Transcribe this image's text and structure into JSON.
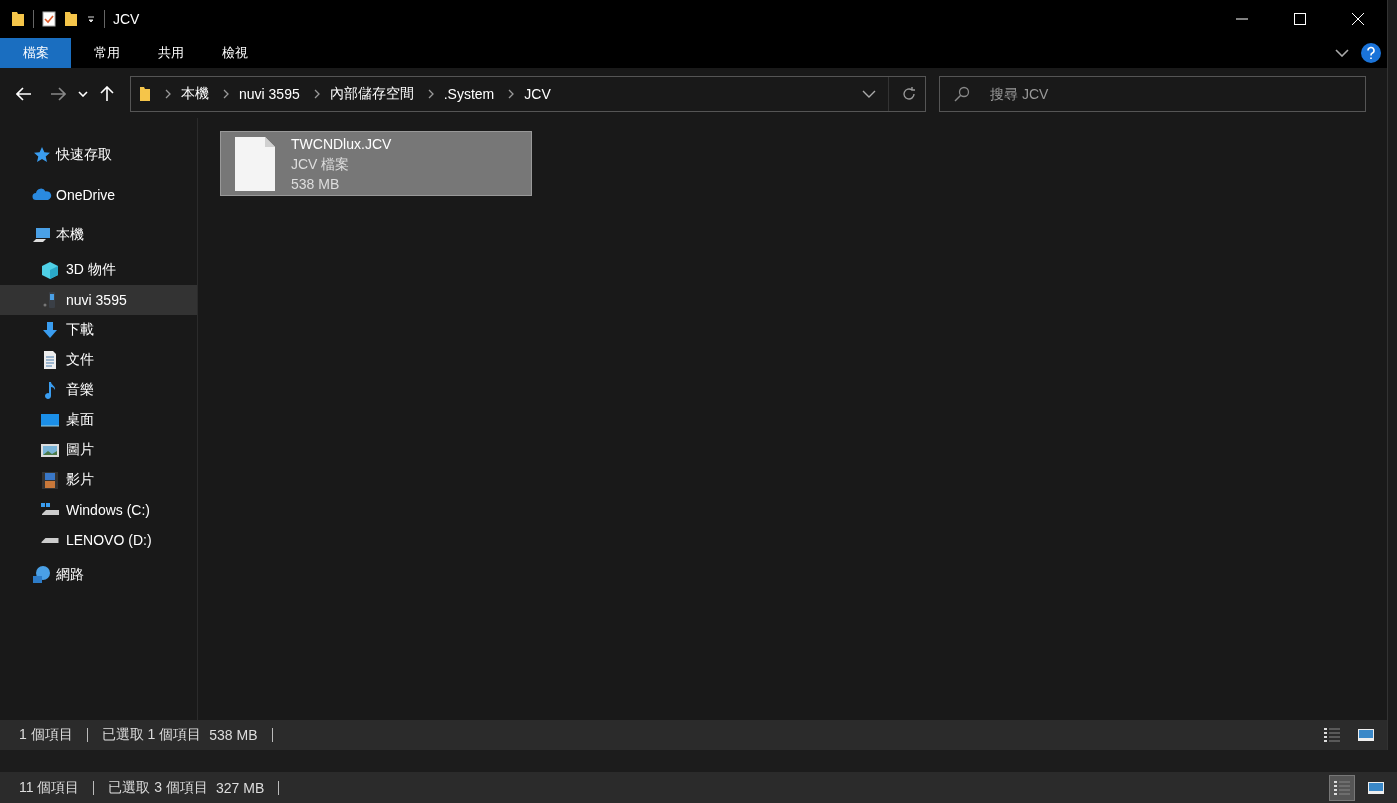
{
  "window": {
    "title": "JCV"
  },
  "ribbon_tabs": [
    {
      "label": "檔案",
      "selected": true
    },
    {
      "label": "常用",
      "selected": false
    },
    {
      "label": "共用",
      "selected": false
    },
    {
      "label": "檢視",
      "selected": false
    }
  ],
  "address_bar": {
    "crumbs": [
      "本機",
      "nuvi 3595",
      "內部儲存空間",
      ".System",
      "JCV"
    ]
  },
  "search": {
    "placeholder": "搜尋 JCV"
  },
  "sidebar": {
    "items": [
      {
        "label": "快速存取",
        "kind": "star",
        "selected": false
      },
      {
        "label": "OneDrive",
        "kind": "cloud",
        "selected": false
      },
      {
        "label": "本機",
        "kind": "pc",
        "selected": false,
        "children": [
          {
            "label": "3D 物件",
            "kind": "cube",
            "selected": false
          },
          {
            "label": "nuvi 3595",
            "kind": "device",
            "selected": true
          },
          {
            "label": "下載",
            "kind": "download",
            "selected": false
          },
          {
            "label": "文件",
            "kind": "document",
            "selected": false
          },
          {
            "label": "音樂",
            "kind": "music",
            "selected": false
          },
          {
            "label": "桌面",
            "kind": "desktop",
            "selected": false
          },
          {
            "label": "圖片",
            "kind": "picture",
            "selected": false
          },
          {
            "label": "影片",
            "kind": "video",
            "selected": false
          },
          {
            "label": "Windows (C:)",
            "kind": "windrive",
            "selected": false
          },
          {
            "label": "LENOVO (D:)",
            "kind": "drive",
            "selected": false
          }
        ]
      },
      {
        "label": "網路",
        "kind": "network",
        "selected": false
      }
    ]
  },
  "files": [
    {
      "name": "TWCNDlux.JCV",
      "type": "JCV 檔案",
      "size": "538 MB",
      "selected": true
    }
  ],
  "status_bar": {
    "item_count": "1 個項目",
    "selection": "已選取 1 個項目",
    "selection_size": "538 MB",
    "views": [
      {
        "kind": "details",
        "selected": false
      },
      {
        "kind": "large_icons",
        "selected": false
      }
    ]
  },
  "background_status_bar": {
    "item_count": "11 個項目",
    "selection": "已選取 3 個項目",
    "selection_size": "327 MB",
    "views": [
      {
        "kind": "details",
        "selected": true
      },
      {
        "kind": "large_icons",
        "selected": false
      }
    ]
  }
}
